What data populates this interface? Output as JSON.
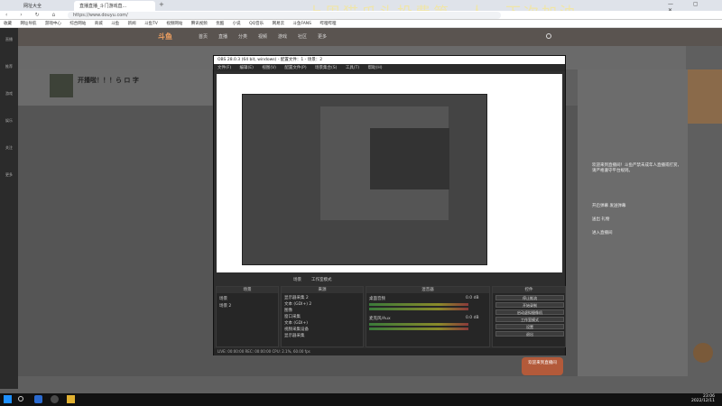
{
  "browser": {
    "tabs": [
      {
        "label": "网址大全",
        "active": false
      },
      {
        "label": "直播直播_斗门游戏直...",
        "active": true
      }
    ],
    "url": "https://www.douyu.com/",
    "bookmarks": [
      "收藏",
      "网址导航",
      "游戏中心",
      "综合网站",
      "商城",
      "斗鱼",
      "新闻",
      "斗鱼TV",
      "视频网站",
      "腾讯视频",
      "优酷",
      "小说",
      "QQ音乐",
      "网易云",
      "斗鱼FANS",
      "哔哩哔哩"
    ]
  },
  "overlay_title": "上周猫爪头投费第一人，下次加油",
  "sidebar": {
    "items": [
      "直播",
      "推荐",
      "游戏",
      "娱乐",
      "关注",
      "更多"
    ]
  },
  "site": {
    "nav": [
      "首页",
      "直播",
      "分类",
      "视频",
      "游戏",
      "社区",
      "更多"
    ],
    "room_title": "开播啦！！！ら ロ 字",
    "chat_lines": [
      "欢迎来到直播间！斗鱼严禁未成年人直播或打赏，请严格遵守平台规则。",
      "开启弹幕 发送弹幕",
      "送出 礼物",
      "进入直播间"
    ],
    "clock_time": "23:06",
    "clock_date": "2022/12/11"
  },
  "obs": {
    "title": "OBS 28.0.3 (64 bit, windows) - 配置文件：1 - 场景：2",
    "menu": [
      "文件(F)",
      "编辑(E)",
      "视图(V)",
      "配置文件(P)",
      "场景集合(S)",
      "工具(T)",
      "帮助(H)"
    ],
    "mode_labels": [
      "场景",
      "工作室模式"
    ],
    "docks": {
      "scenes": {
        "title": "场景",
        "items": [
          "场景",
          "场景 2"
        ]
      },
      "sources": {
        "title": "来源",
        "items": [
          "显示器采集 2",
          "文本 (GDI+) 2",
          "图像",
          "窗口采集",
          "文本 (GDI+)",
          "视频采集设备",
          "显示器采集"
        ]
      },
      "mixer": {
        "title": "混音器",
        "items": [
          "桌面音频",
          "麦克风/Aux"
        ],
        "db": [
          "0.0 dB",
          "0.0 dB"
        ]
      },
      "controls": {
        "title": "控件",
        "buttons": [
          "停止推流",
          "开始录制",
          "启动虚拟摄像机",
          "工作室模式",
          "设置",
          "退出"
        ]
      }
    },
    "status": "LIVE: 00:00:00   REC: 00:00:00   CPU: 2.1%, 60.00 fps"
  },
  "gift_label": "欢迎来到直播间",
  "colors": {
    "accent": "#ff7a1a",
    "obs_bg": "#2e2e2e"
  }
}
